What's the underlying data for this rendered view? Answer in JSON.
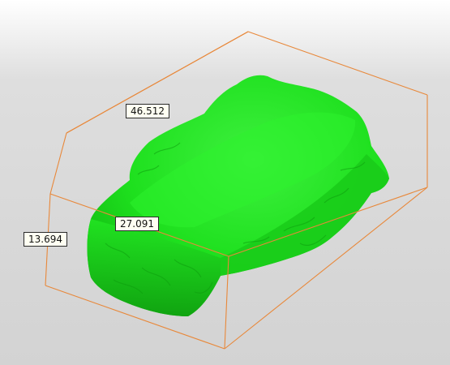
{
  "viewport": {
    "background_top": "#ffffff",
    "background_bottom": "#d3d3d3"
  },
  "bounding_box": {
    "color": "#e8883a",
    "dimensions": {
      "length": "46.512",
      "width": "27.091",
      "height": "13.694"
    }
  },
  "model": {
    "color": "#1ee81e",
    "shade_color": "#0c9a0c"
  }
}
